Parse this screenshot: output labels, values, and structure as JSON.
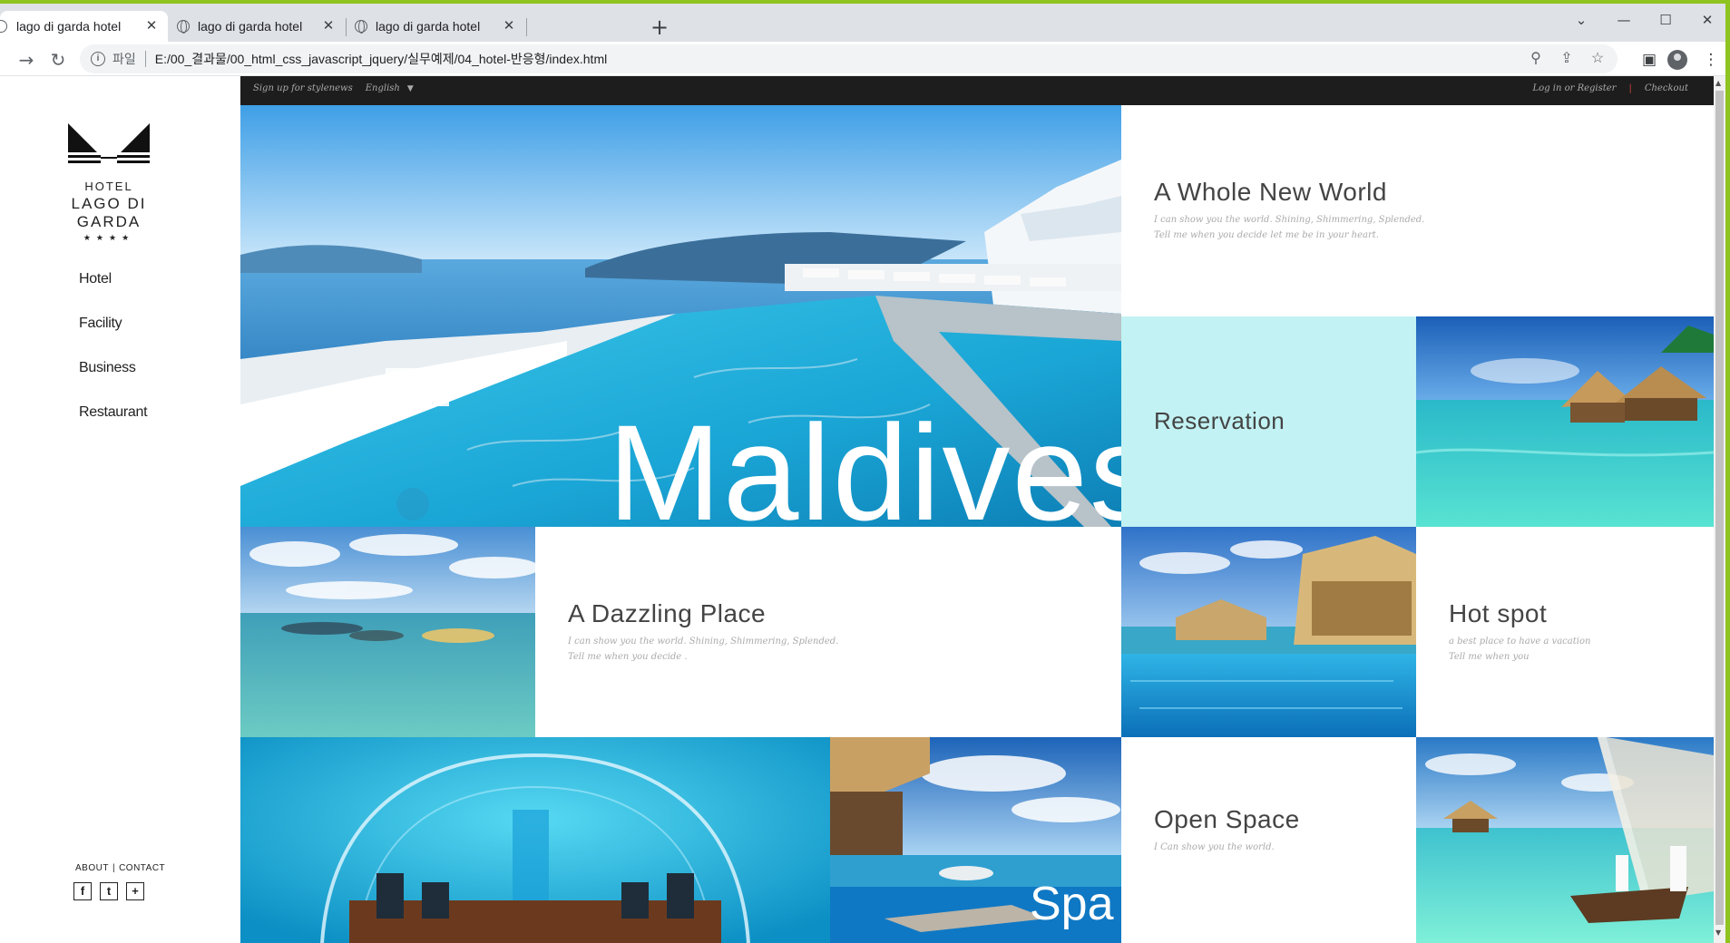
{
  "browser": {
    "tabs": [
      {
        "title": "lago di garda hotel",
        "active": true
      },
      {
        "title": "lago di garda hotel",
        "active": false
      },
      {
        "title": "lago di garda hotel",
        "active": false
      }
    ],
    "scheme_label": "파일",
    "url": "E:/00_결과물/00_html_css_javascript_jquery/실무예제/04_hotel-반응형/index.html",
    "accent_color": "#8fc31f"
  },
  "sidebar": {
    "logo": {
      "line1": "HOTEL",
      "line2": "LAGO DI GARDA",
      "stars": "★★★★"
    },
    "menu": [
      "Hotel",
      "Facility",
      "Business",
      "Restaurant"
    ],
    "footer": {
      "about": "ABOUT",
      "sep": "|",
      "contact": "CONTACT"
    },
    "socials": [
      "f",
      "t",
      "+"
    ]
  },
  "topbar": {
    "signup": "Sign up for stylenews",
    "language": "English",
    "login": "Log in or Register",
    "sep": "|",
    "checkout": "Checkout"
  },
  "tiles": {
    "hero_word": "Maldives",
    "whole_new_world": {
      "title": "A Whole New World",
      "line1": "I can show you the world. Shining, Shimmering, Splended.",
      "line2": "Tell me when you decide let me be in your heart."
    },
    "reservation": {
      "title": "Reservation",
      "bg": "#c2f2f3"
    },
    "dazzling": {
      "title": "A Dazzling Place",
      "line1": "I can show you the world. Shining, Shimmering, Splended.",
      "line2": "Tell me when you decide ."
    },
    "hot_spot": {
      "title": "Hot spot",
      "line1": "a best place to have a vacation",
      "line2": "Tell me when you"
    },
    "spa_word": "Spa",
    "open_space": {
      "title": "Open Space",
      "line1": "I Can show you the world."
    }
  }
}
